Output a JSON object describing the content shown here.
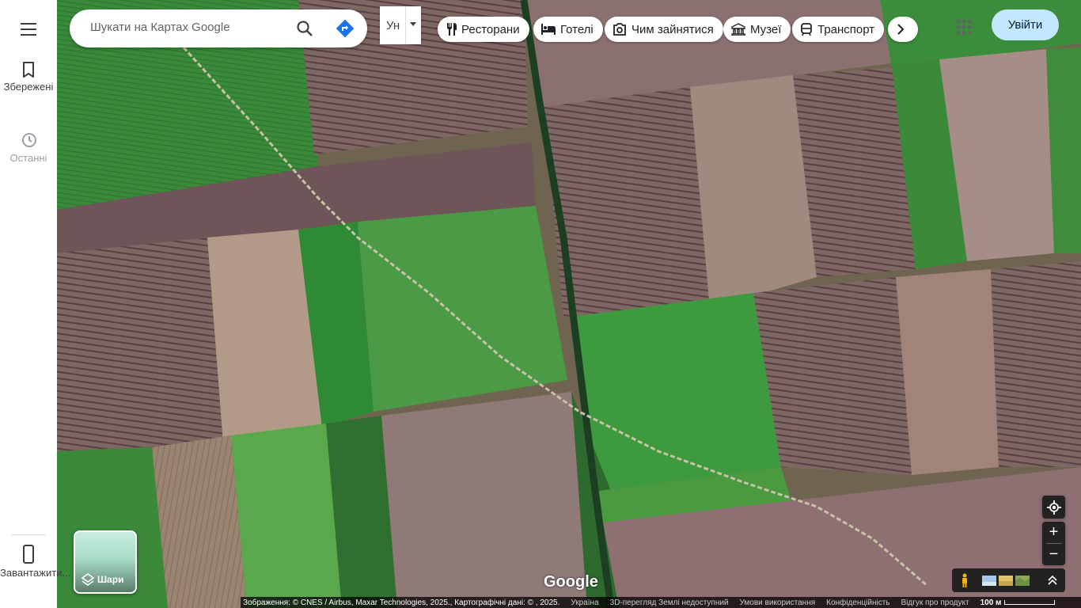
{
  "sidebar": {
    "menu_icon": "hamburger-menu-icon",
    "saved_label": "Збережені",
    "recent_label": "Останні",
    "download_label": "Завантажити..."
  },
  "search": {
    "placeholder": "Шукати на Картах Google",
    "search_icon": "search-icon",
    "directions_icon": "directions-icon"
  },
  "language": {
    "label": "Ун"
  },
  "chips": [
    {
      "label": "Ресторани",
      "icon": "restaurant-icon"
    },
    {
      "label": "Готелі",
      "icon": "hotel-icon"
    },
    {
      "label": "Чим зайнятися",
      "icon": "camera-icon"
    },
    {
      "label": "Музеї",
      "icon": "museum-icon"
    },
    {
      "label": "Транспорт",
      "icon": "transit-icon"
    }
  ],
  "header": {
    "signin_label": "Увійти",
    "apps_icon": "apps-grid-icon"
  },
  "layers": {
    "label": "Шари"
  },
  "logo": {
    "text": "Google"
  },
  "footer": {
    "attribution": "Зображення: © CNES / Airbus, Maxar Technologies, 2025., Картографічні дані: © , 2025.",
    "country": "Україна",
    "unavailable_3d": "3D-перегляд Землі недоступний",
    "terms": "Умови використання",
    "privacy": "Конфіденційність",
    "feedback": "Відгук про продукт",
    "scale": "100 м"
  },
  "colors": {
    "signin_bg": "#c2e7ff",
    "directions": "#1a73e8",
    "field_green": "#3f8f3a",
    "field_brown": "#7d6660"
  }
}
